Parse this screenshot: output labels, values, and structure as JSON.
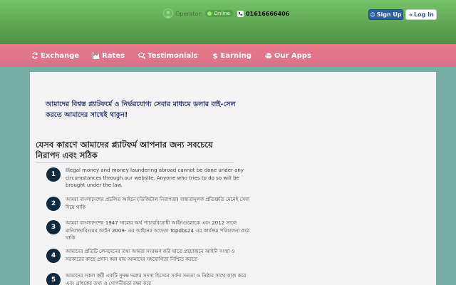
{
  "header": {
    "operator_label": "Operator:",
    "status": "Online",
    "phone": "01616666406",
    "signup_label": "Sign Up",
    "login_label": "Log In"
  },
  "nav": {
    "items": [
      {
        "label": "Exchange",
        "icon": "sync-icon"
      },
      {
        "label": "Rates",
        "icon": "chart-icon"
      },
      {
        "label": "Testimonials",
        "icon": "comments-icon"
      },
      {
        "label": "Earning",
        "icon": "dollar-icon"
      },
      {
        "label": "Our Apps",
        "icon": "android-icon"
      }
    ]
  },
  "main": {
    "intro": "আমাদের বিশ্বস্ত প্ল্যাটফর্মে ও নির্ভরযোগ্য সেবার মাধ্যমে ডলার বাই-সেল করতে আমাদের সাথেই থাকুন!",
    "section_title": "যেসব কারণে আমাদের প্ল্যাটফর্ম আপনার জন্য সবচেয়ে নিরাপদ এবং সঠিক",
    "rules": [
      {
        "num": "1",
        "text": "Illegal money and money laundering abroad cannot be done under any circumstances through our website. Anyone who tries to do so will be brought under the law."
      },
      {
        "num": "2",
        "text": "আমরা বাংলাদেশের প্রচলিত আইনে (ডিজিটাল নিরাপত্তা) বাধ্যতামূলক প্রতিশ্রুতি মেনেই সেবা দিয়ে থাকি"
      },
      {
        "num": "3",
        "text": "আমরা বাংলাদেশের 1947 সালের অর্থ পাচারবিরোধী আইনগুলোকে এবং 2012 সালে মানিলন্ডারিংয়ের আইন 2009- এর আইনের আওতা Topdbs24 এর কার্যক্রম পরিচালনা করে থাকি"
      },
      {
        "num": "4",
        "text": "আমাদের প্রতিটি লেনদেনের তথ্য আমরা সংরক্ষণ করি যাতে প্রয়োজনে আইনি সংস্থা ও সরকারের কাছে প্রদান করা যায় আমাদের সহযোগিতা নিশ্চিত করতে"
      },
      {
        "num": "5",
        "text": "আমাদের সকল কর্মী একটি সুদক্ষ দলের সদস্য হিসেবে সর্বদা সততা ও নিষ্ঠার সাথে কাজ করে এবং গ্রাহকের তথ্য ও গোপনীয়তা রক্ষা করে"
      }
    ]
  },
  "colors": {
    "header_green": "#5fa651",
    "nav_pink": "#e07489",
    "page_teal": "#76aea6",
    "badge_navy": "#0f2a3f",
    "signup_blue": "#2a5fa6"
  }
}
